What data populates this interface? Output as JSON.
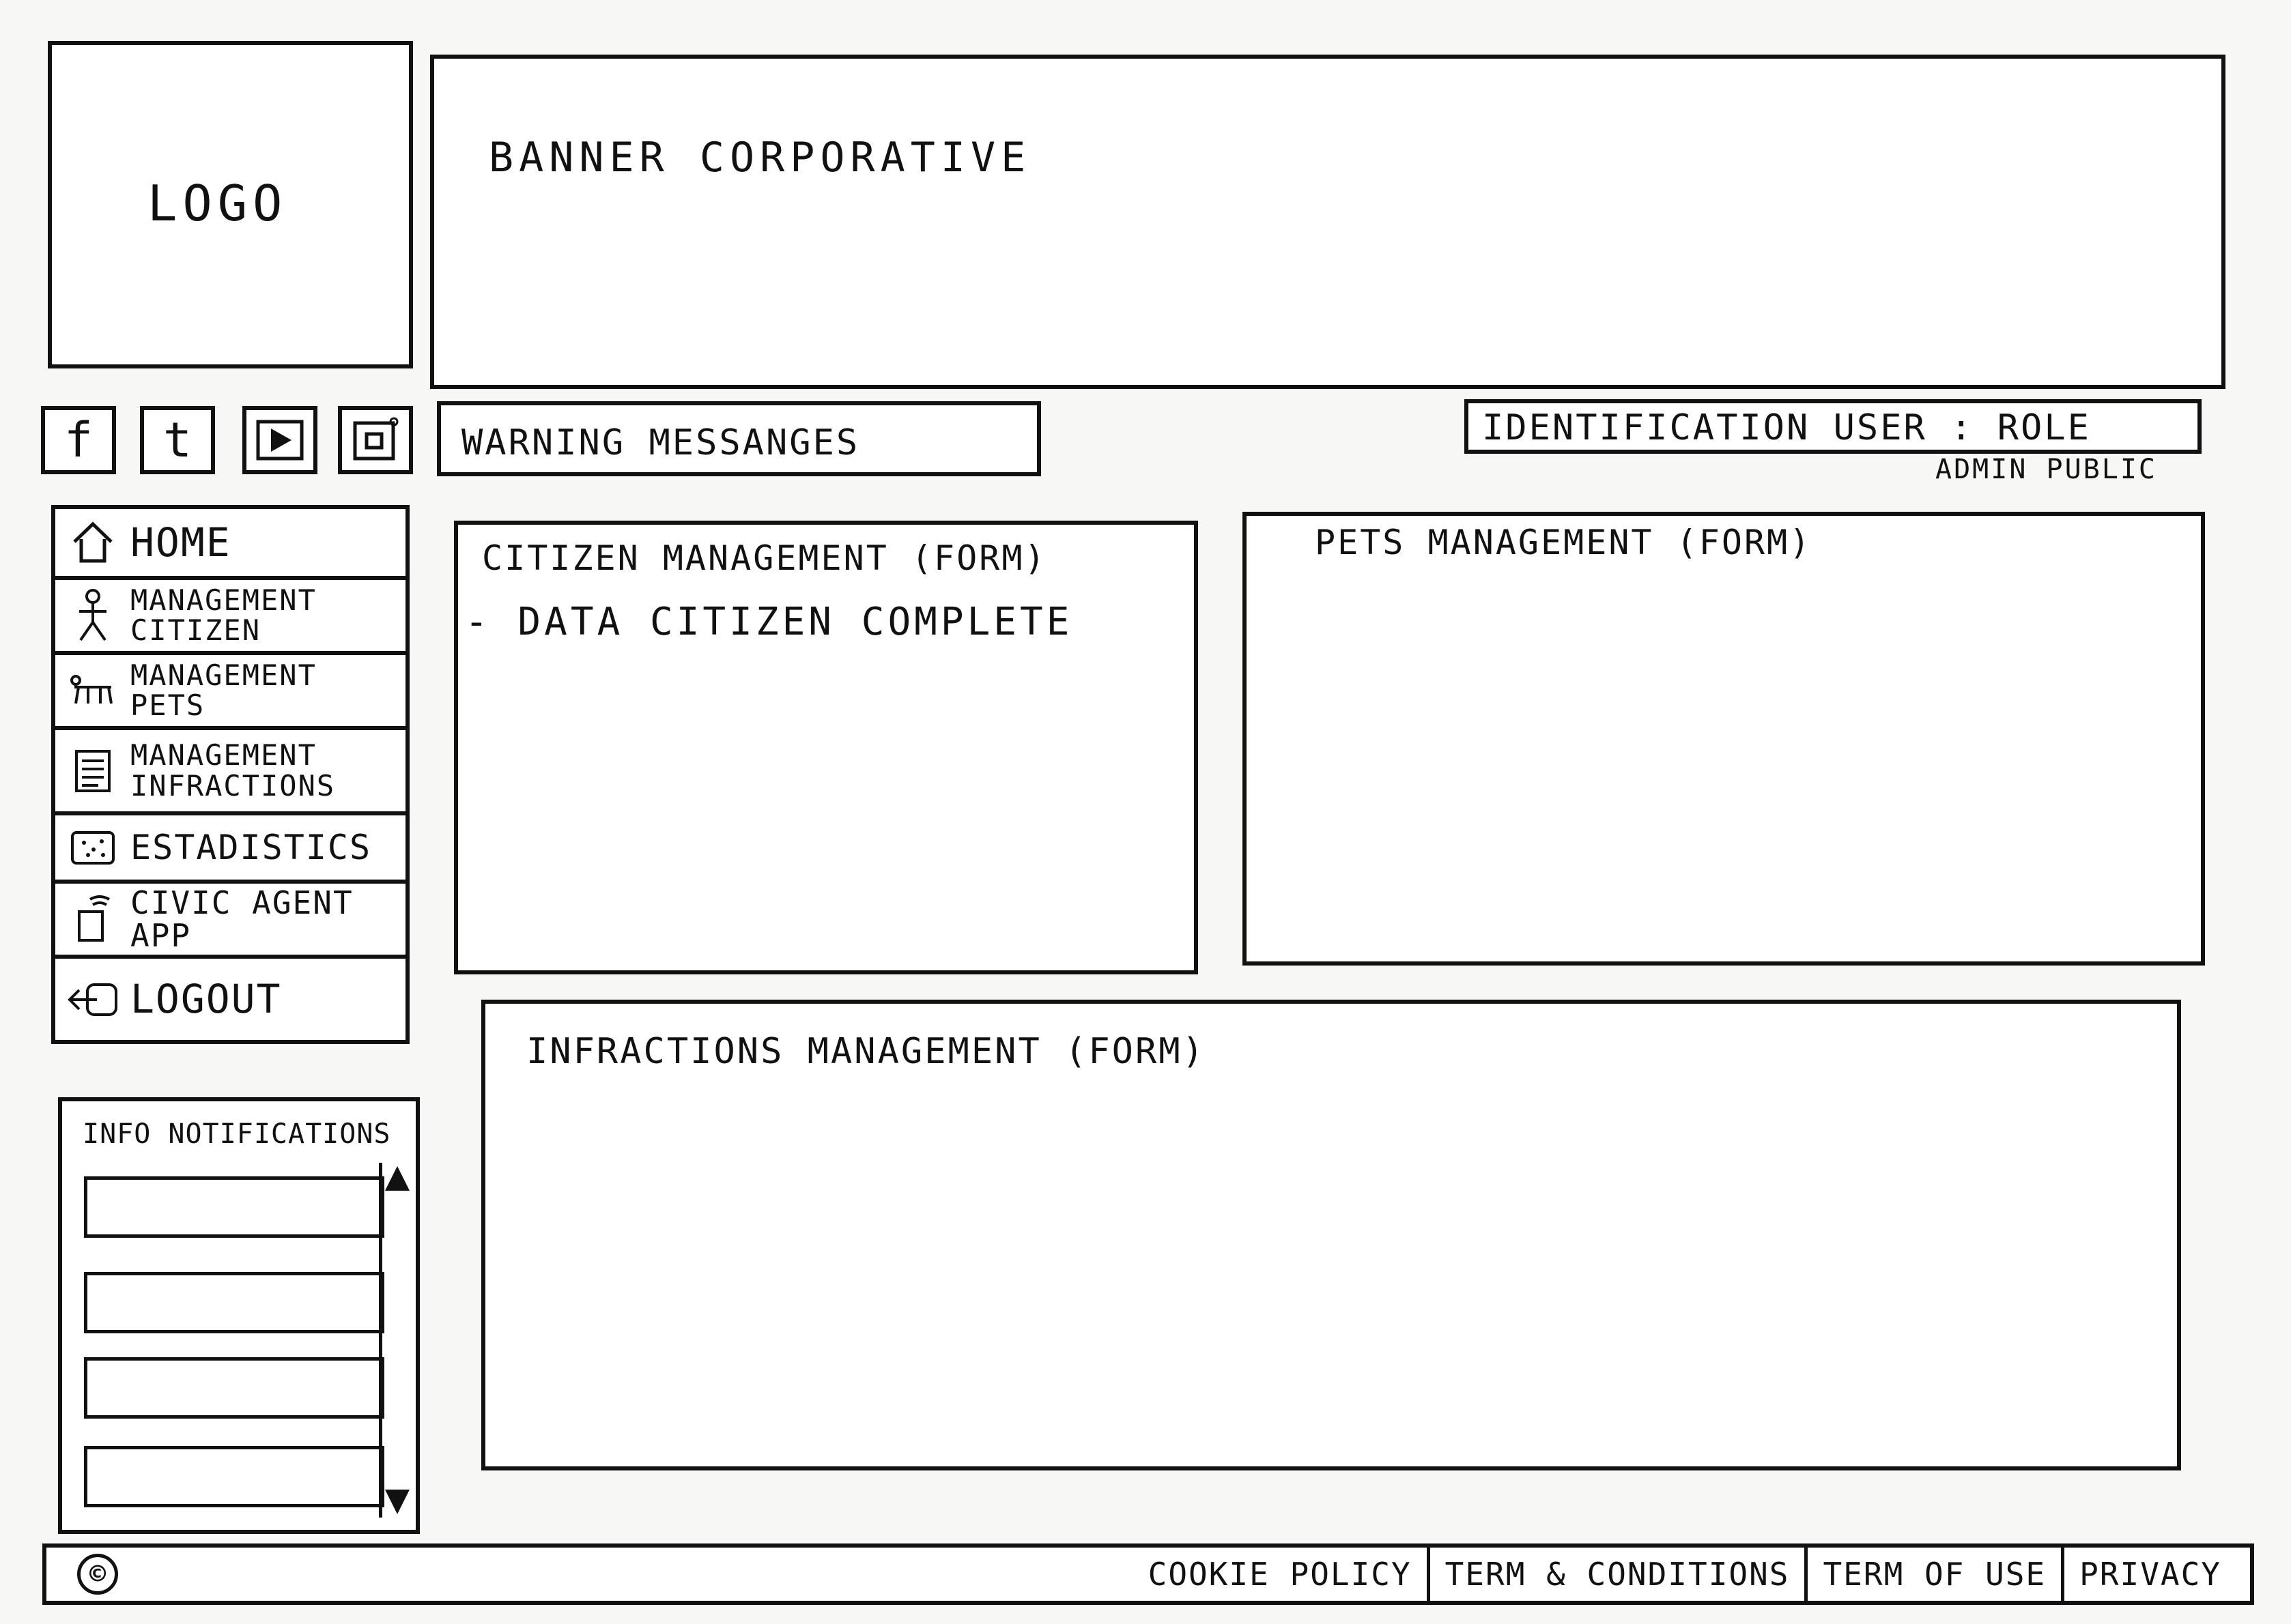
{
  "header": {
    "logo": "LOGO",
    "banner": "BANNER CORPORATIVE"
  },
  "social": {
    "facebook": "f",
    "twitter": "t"
  },
  "warning": "WARNING MESSANGES",
  "user": {
    "identification": "IDENTIFICATION USER : ROLE",
    "roles": "ADMIN PUBLIC"
  },
  "nav": {
    "home": "HOME",
    "citizen": "MANAGEMENT\nCITIZEN",
    "pets": "MANAGEMENT\nPETS",
    "infractions": "MANAGEMENT\nINFRACTIONS",
    "statistics": "ESTADISTICS",
    "civic": "CIVIC AGENT APP",
    "logout": "LOGOUT"
  },
  "notifications": {
    "title": "INFO NOTIFICATIONS"
  },
  "forms": {
    "citizen_title": "CITIZEN MANAGEMENT (FORM)",
    "citizen_line": "- DATA CITIZEN COMPLETE",
    "pets_title": "PETS MANAGEMENT (FORM)",
    "infractions_title": "INFRACTIONS MANAGEMENT (FORM)"
  },
  "footer": {
    "copyright": "©",
    "cookie": "COOKIE POLICY",
    "terms_conditions": "TERM & CONDITIONS",
    "terms_use": "TERM OF USE",
    "privacy": "PRIVACY"
  }
}
